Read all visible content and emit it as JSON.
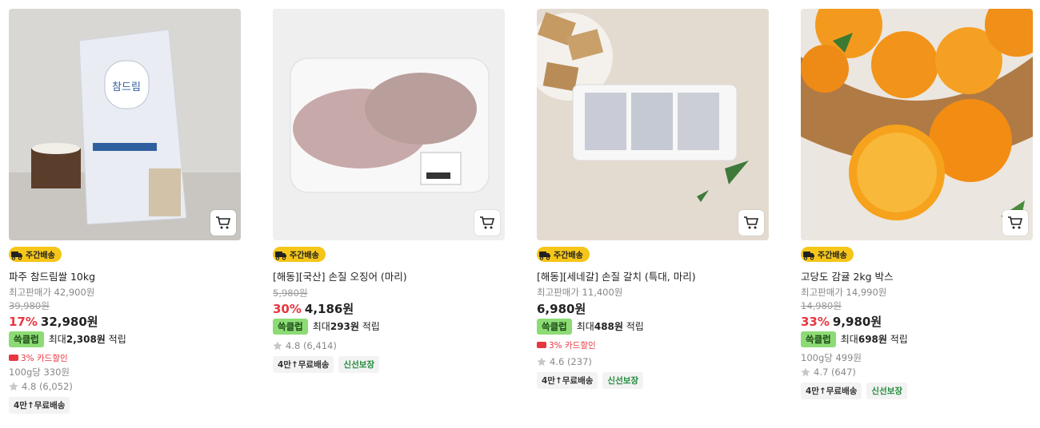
{
  "icons": {
    "cart": "cart-icon",
    "truck": "truck-icon",
    "star": "star-icon",
    "card": "credit-card-icon"
  },
  "colors": {
    "discount": "#e8363f",
    "weekly_badge": "#f5c518",
    "reward_badge": "#8ddb75",
    "fresh_tag": "#1f8a3a"
  },
  "products": [
    {
      "badge": "주간배송",
      "name": "파주 참드림쌀 10kg",
      "min_price_label": "최고판매가 42,900원",
      "original_price": "39,980원",
      "discount": "17%",
      "price": "32,980원",
      "reward_badge": "쓱클럽",
      "reward_prefix": "최대",
      "reward_amount": "2,308원",
      "reward_suffix": "적립",
      "card_discount": "3% 카드할인",
      "unit_price": "100g당 330원",
      "rating": "4.8 (6,052)",
      "tags": [
        "4만↑무료배송"
      ]
    },
    {
      "badge": "주간배송",
      "name": "[해동][국산] 손질 오징어 (마리)",
      "original_price": "5,980원",
      "discount": "30%",
      "price": "4,186원",
      "reward_badge": "쓱클럽",
      "reward_prefix": "최대",
      "reward_amount": "293원",
      "reward_suffix": "적립",
      "rating": "4.8 (6,414)",
      "tags": [
        "4만↑무료배송",
        "신선보장"
      ]
    },
    {
      "badge": "주간배송",
      "name": "[해동][세네갈] 손질 갈치 (특대, 마리)",
      "min_price_label": "최고판매가 11,400원",
      "price": "6,980원",
      "reward_badge": "쓱클럽",
      "reward_prefix": "최대",
      "reward_amount": "488원",
      "reward_suffix": "적립",
      "card_discount": "3% 카드할인",
      "rating": "4.6 (237)",
      "tags": [
        "4만↑무료배송",
        "신선보장"
      ]
    },
    {
      "badge": "주간배송",
      "name": "고당도 감귤 2kg 박스",
      "min_price_label": "최고판매가 14,990원",
      "original_price": "14,980원",
      "discount": "33%",
      "price": "9,980원",
      "reward_badge": "쓱클럽",
      "reward_prefix": "최대",
      "reward_amount": "698원",
      "reward_suffix": "적립",
      "unit_price": "100g당 499원",
      "rating": "4.7 (647)",
      "tags": [
        "4만↑무료배송",
        "신선보장"
      ]
    }
  ]
}
